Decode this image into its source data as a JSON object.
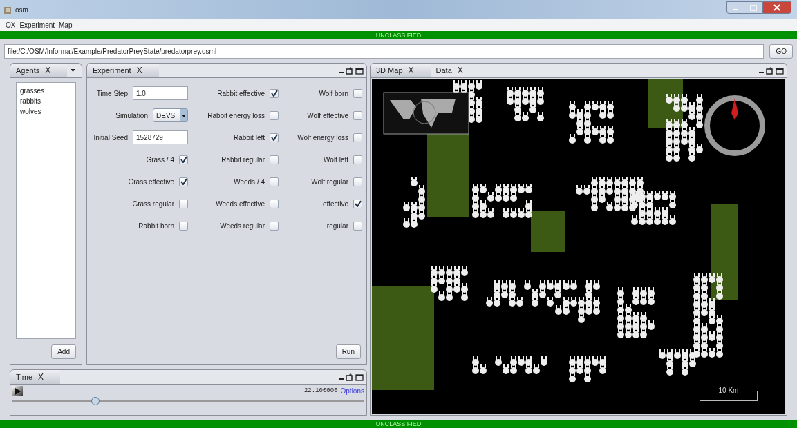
{
  "window": {
    "title": "osm"
  },
  "menu": [
    "OX",
    "Experiment",
    "Map"
  ],
  "banner_top": "UNCLASSIFIED",
  "address": {
    "value": "file:/C:/OSM/Informal/Example/PredatorPreyState/predatorprey.osml",
    "button": "GO"
  },
  "agents_panel": {
    "tab": "Agents",
    "close": "X",
    "items": [
      {
        "label": "grasses",
        "selected": false
      },
      {
        "label": "rabbits",
        "selected": false
      },
      {
        "label": "wolves",
        "selected": false
      }
    ],
    "button": "Add"
  },
  "experiment_panel": {
    "tab": "Experiment",
    "close": "X",
    "columns": [
      [
        {
          "kind": "text",
          "label": "Time Step",
          "value": "1.0"
        },
        {
          "kind": "select",
          "label": "Simulation",
          "value": "DEVS"
        },
        {
          "kind": "text",
          "label": "Initial Seed",
          "value": "1528729"
        },
        {
          "kind": "checkbox",
          "label": "Grass / 4",
          "checked": true
        },
        {
          "kind": "checkbox",
          "label": "Grass effective",
          "checked": true
        },
        {
          "kind": "checkbox",
          "label": "Grass regular",
          "checked": false
        },
        {
          "kind": "checkbox",
          "label": "Rabbit born",
          "checked": false
        }
      ],
      [
        {
          "kind": "checkbox",
          "label": "Rabbit effective",
          "checked": true
        },
        {
          "kind": "checkbox",
          "label": "Rabbit energy loss",
          "checked": false
        },
        {
          "kind": "checkbox",
          "label": "Rabbit left",
          "checked": true
        },
        {
          "kind": "checkbox",
          "label": "Rabbit regular",
          "checked": false
        },
        {
          "kind": "checkbox",
          "label": "Weeds / 4",
          "checked": false
        },
        {
          "kind": "checkbox",
          "label": "Weeds effective",
          "checked": false
        },
        {
          "kind": "checkbox",
          "label": "Weeds regular",
          "checked": false
        }
      ],
      [
        {
          "kind": "checkbox",
          "label": "Wolf born",
          "checked": false
        },
        {
          "kind": "checkbox",
          "label": "Wolf effective",
          "checked": false
        },
        {
          "kind": "checkbox",
          "label": "Wolf energy loss",
          "checked": false
        },
        {
          "kind": "checkbox",
          "label": "Wolf left",
          "checked": false
        },
        {
          "kind": "checkbox",
          "label": "Wolf regular",
          "checked": false
        },
        {
          "kind": "checkbox",
          "label": "effective",
          "checked": true
        },
        {
          "kind": "checkbox",
          "label": "regular",
          "checked": false
        }
      ]
    ],
    "button": "Run"
  },
  "time_panel": {
    "tab": "Time",
    "close": "X",
    "reading": "22.100000",
    "link": "Options",
    "slider": {
      "level": 0.23
    }
  },
  "map_panel": {
    "tabs": [
      {
        "label": "3D Map",
        "close": "X",
        "selected": true
      },
      {
        "label": "Data",
        "close": "X",
        "selected": false
      }
    ],
    "scale": "10 Km"
  },
  "banner_bottom": "UNCLASSIFIED"
}
